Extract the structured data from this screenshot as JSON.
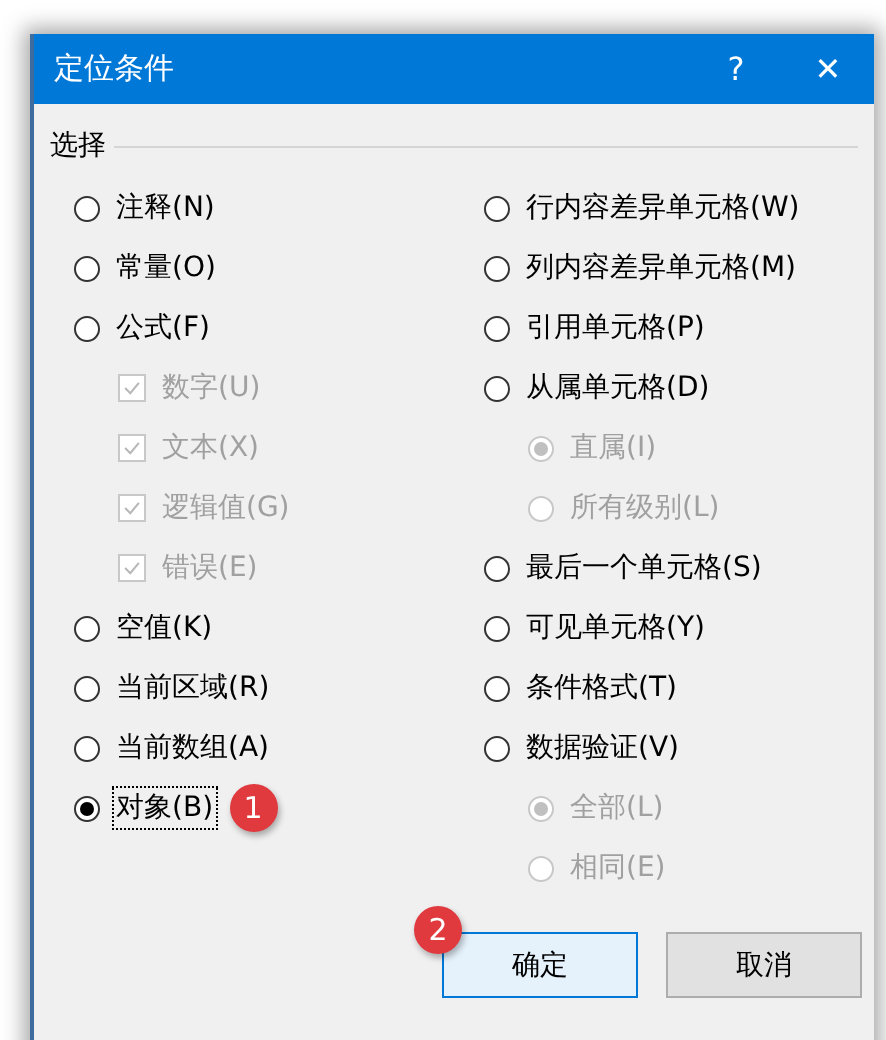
{
  "window": {
    "title": "定位条件",
    "help": "?",
    "close": "✕"
  },
  "group": {
    "label": "选择"
  },
  "left_options": [
    {
      "label": "注释(N)",
      "kind": "radio",
      "selected": false,
      "disabled": false
    },
    {
      "label": "常量(O)",
      "kind": "radio",
      "selected": false,
      "disabled": false
    },
    {
      "label": "公式(F)",
      "kind": "radio",
      "selected": false,
      "disabled": false
    },
    {
      "label": "数字(U)",
      "kind": "checkbox",
      "checked": true,
      "disabled": true
    },
    {
      "label": "文本(X)",
      "kind": "checkbox",
      "checked": true,
      "disabled": true
    },
    {
      "label": "逻辑值(G)",
      "kind": "checkbox",
      "checked": true,
      "disabled": true
    },
    {
      "label": "错误(E)",
      "kind": "checkbox",
      "checked": true,
      "disabled": true
    },
    {
      "label": "空值(K)",
      "kind": "radio",
      "selected": false,
      "disabled": false
    },
    {
      "label": "当前区域(R)",
      "kind": "radio",
      "selected": false,
      "disabled": false
    },
    {
      "label": "当前数组(A)",
      "kind": "radio",
      "selected": false,
      "disabled": false
    },
    {
      "label": "对象(B)",
      "kind": "radio",
      "selected": true,
      "disabled": false,
      "focused": true,
      "badge": "1"
    }
  ],
  "right_options": [
    {
      "label": "行内容差异单元格(W)",
      "kind": "radio",
      "selected": false,
      "disabled": false
    },
    {
      "label": "列内容差异单元格(M)",
      "kind": "radio",
      "selected": false,
      "disabled": false
    },
    {
      "label": "引用单元格(P)",
      "kind": "radio",
      "selected": false,
      "disabled": false
    },
    {
      "label": "从属单元格(D)",
      "kind": "radio",
      "selected": false,
      "disabled": false
    },
    {
      "label": "直属(I)",
      "kind": "subradio",
      "selected": true,
      "disabled": true
    },
    {
      "label": "所有级别(L)",
      "kind": "subradio",
      "selected": false,
      "disabled": true
    },
    {
      "label": "最后一个单元格(S)",
      "kind": "radio",
      "selected": false,
      "disabled": false
    },
    {
      "label": "可见单元格(Y)",
      "kind": "radio",
      "selected": false,
      "disabled": false
    },
    {
      "label": "条件格式(T)",
      "kind": "radio",
      "selected": false,
      "disabled": false
    },
    {
      "label": "数据验证(V)",
      "kind": "radio",
      "selected": false,
      "disabled": false
    },
    {
      "label": "全部(L)",
      "kind": "subradio",
      "selected": true,
      "disabled": true
    },
    {
      "label": "相同(E)",
      "kind": "subradio",
      "selected": false,
      "disabled": true
    }
  ],
  "buttons": [
    {
      "label": "确定",
      "default": true,
      "badge": "2"
    },
    {
      "label": "取消",
      "default": false
    }
  ]
}
